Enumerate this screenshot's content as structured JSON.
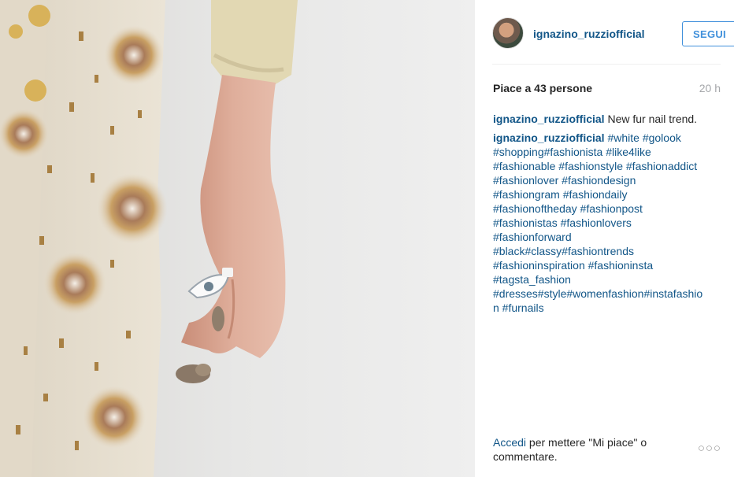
{
  "photo": {
    "description_icon": "fashion-photo",
    "colors": {
      "background": "#e6e6e6",
      "jacket": "#e4dccf",
      "skin": "#d9a995",
      "beads": "#b48a3c",
      "fur": "#8a7a6a"
    }
  },
  "header": {
    "username": "ignazino_ruzziofficial",
    "follow_label": "SEGUI"
  },
  "post": {
    "likes": "Piace a 43 persone",
    "time": "20 h",
    "caption": {
      "author": "ignazino_ruzziofficial",
      "text": " New fur nail trend."
    },
    "hashtag_comment": {
      "author": "ignazino_ruzziofficial",
      "lines": [
        " #white #golook",
        "#shopping#fashionista #like4like",
        "#fashionable #fashionstyle #fashionaddict",
        "#fashionlover #fashiondesign",
        "#fashiongram #fashiondaily",
        "#fashionoftheday #fashionpost",
        "#fashionistas #fashionlovers",
        "#fashionforward",
        "#black#classy#fashiontrends",
        "#fashioninspiration #fashioninsta",
        "#tagsta_fashion",
        "#dresses#style#womenfashion#instafashio",
        "n #furnails"
      ]
    }
  },
  "footer": {
    "login_link": "Accedi",
    "login_text": " per mettere \"Mi piace\" o commentare.",
    "more_icon": "ellipsis-icon",
    "more_glyph": "○○○"
  }
}
